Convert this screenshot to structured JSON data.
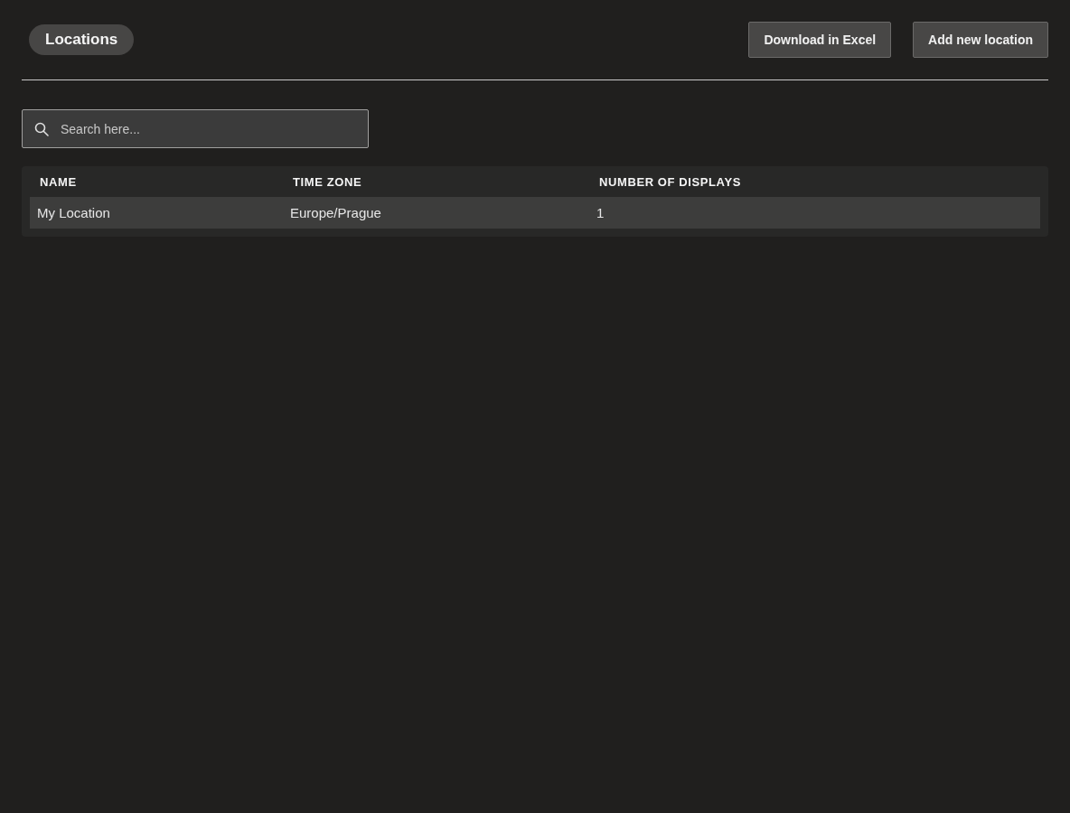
{
  "header": {
    "title": "Locations",
    "buttons": [
      "Download in Excel",
      "Add new location"
    ]
  },
  "search": {
    "placeholder": "Search here..."
  },
  "table": {
    "columns": [
      "NAME",
      "TIME ZONE",
      "NUMBER OF DISPLAYS"
    ],
    "rows": [
      {
        "cells": [
          "My Location",
          "Europe/Prague",
          "1"
        ]
      }
    ]
  }
}
